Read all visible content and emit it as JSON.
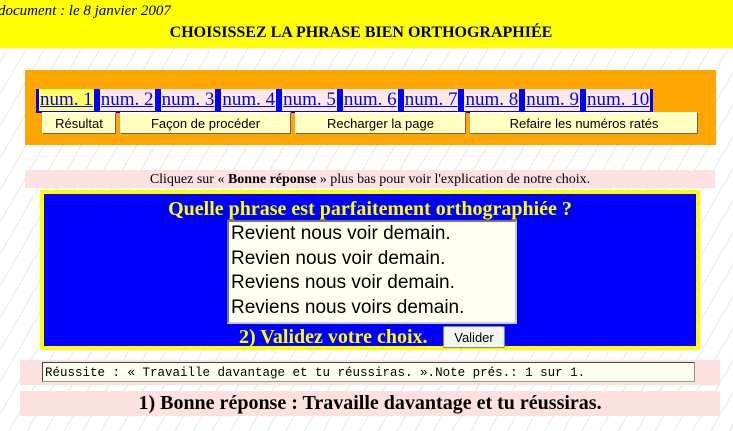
{
  "header": {
    "date": "document : le 8 janvier 2007",
    "title": "CHOISISSEZ LA PHRASE BIEN ORTHOGRAPHIÉE"
  },
  "tabs": [
    "num. 1",
    "num. 2",
    "num. 3",
    "num. 4",
    "num. 5",
    "num. 6",
    "num. 7",
    "num. 8",
    "num. 9",
    "num. 10"
  ],
  "active_tab": "num. 1",
  "buttons": {
    "result": "Résultat",
    "method": "Façon de procéder",
    "reload": "Recharger la page",
    "redo": "Refaire les numéros ratés"
  },
  "info": {
    "pre": "Cliquez sur « ",
    "bold": "Bonne réponse",
    "post": " » plus bas pour voir l'explication de notre choix."
  },
  "quiz": {
    "question": "Quelle phrase est parfaitement orthographiée ?",
    "options": [
      "Revient nous voir demain.",
      "Revien nous voir demain.",
      "Reviens nous voir demain.",
      "Reviens nous voirs demain."
    ],
    "validate_label": "2) Validez votre choix.",
    "validate_button": "Valider"
  },
  "result": "Réussite : « Travaille davantage et tu réussiras. ».Note prés.: 1 sur 1.",
  "answer": "1) Bonne réponse : Travaille davantage et tu réussiras."
}
